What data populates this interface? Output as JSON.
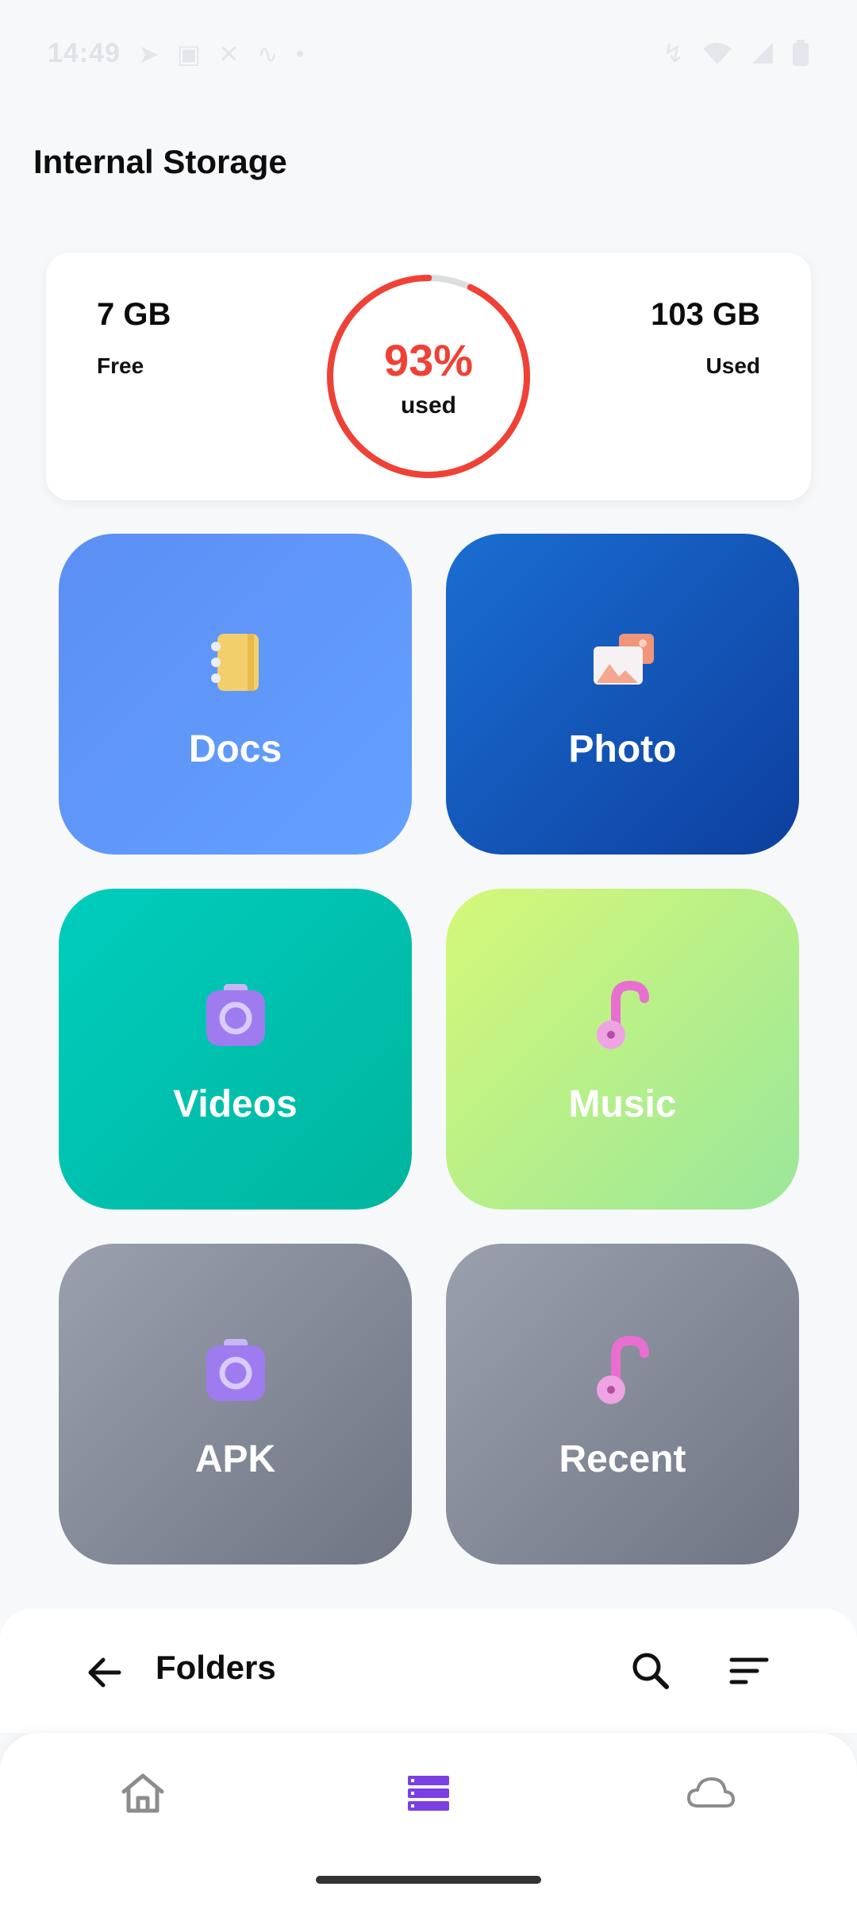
{
  "status_bar": {
    "time": "14:49",
    "left_icons": [
      "telegram-icon",
      "linkedin-icon",
      "x-icon",
      "waveform-icon",
      "dot-icon"
    ],
    "right_icons": [
      "bluetooth-icon",
      "wifi-icon",
      "signal-icon",
      "battery-icon"
    ]
  },
  "page": {
    "title": "Internal Storage"
  },
  "storage": {
    "free_value": "7 GB",
    "free_label": "Free",
    "used_value": "103 GB",
    "used_label": "Used",
    "percent_text": "93%",
    "percent_sub": "used",
    "used_fraction": 0.93,
    "ring_color": "#ef4136",
    "ring_track_color": "#dddddd"
  },
  "categories": [
    {
      "label": "Docs",
      "icon": "notebook-icon"
    },
    {
      "label": "Photo",
      "icon": "photos-icon"
    },
    {
      "label": "Videos",
      "icon": "camera-icon"
    },
    {
      "label": "Music",
      "icon": "music-note-icon"
    },
    {
      "label": "APK",
      "icon": "camera-icon"
    },
    {
      "label": "Recent",
      "icon": "music-note-icon"
    }
  ],
  "folders_bar": {
    "title": "Folders"
  },
  "bottom_nav": {
    "items": [
      "home-icon",
      "files-list-icon",
      "cloud-icon"
    ],
    "active_color": "#7b3fe4",
    "inactive_color": "#8c8c8c"
  }
}
